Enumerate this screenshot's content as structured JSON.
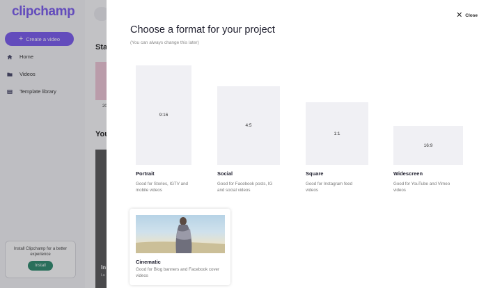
{
  "app": {
    "logo": "clipchamp",
    "create_button": "Create a video",
    "nav": [
      {
        "label": "Home",
        "icon": "home-icon"
      },
      {
        "label": "Videos",
        "icon": "folder-icon"
      },
      {
        "label": "Template library",
        "icon": "template-icon"
      }
    ],
    "install_message": "Install Clipchamp for a better experience",
    "install_button": "Install",
    "bg_heading_1": "Sta",
    "bg_heading_2": "You",
    "bg_card_label": "20",
    "bg_card_text": "In",
    "bg_card_sub": "La"
  },
  "modal": {
    "close_label": "Close",
    "title": "Choose a format for your project",
    "subtitle": "(You can always change this later)",
    "formats": [
      {
        "ratio": "9:16",
        "name": "Portrait",
        "description": "Good for Stories, IGTV and mobile videos"
      },
      {
        "ratio": "4:5",
        "name": "Social",
        "description": "Good for Facebook posts, IG and social videos"
      },
      {
        "ratio": "1:1",
        "name": "Square",
        "description": "Good for Instagram feed videos"
      },
      {
        "ratio": "16:9",
        "name": "Widescreen",
        "description": "Good for YouTube and Vimeo videos"
      }
    ],
    "cinematic": {
      "name": "Cinematic",
      "description": "Good for Blog banners and Facebook cover videos"
    }
  },
  "colors": {
    "brand": "#7b5cf0",
    "install_green": "#2e8b6e",
    "format_box": "#f0f0f4"
  }
}
